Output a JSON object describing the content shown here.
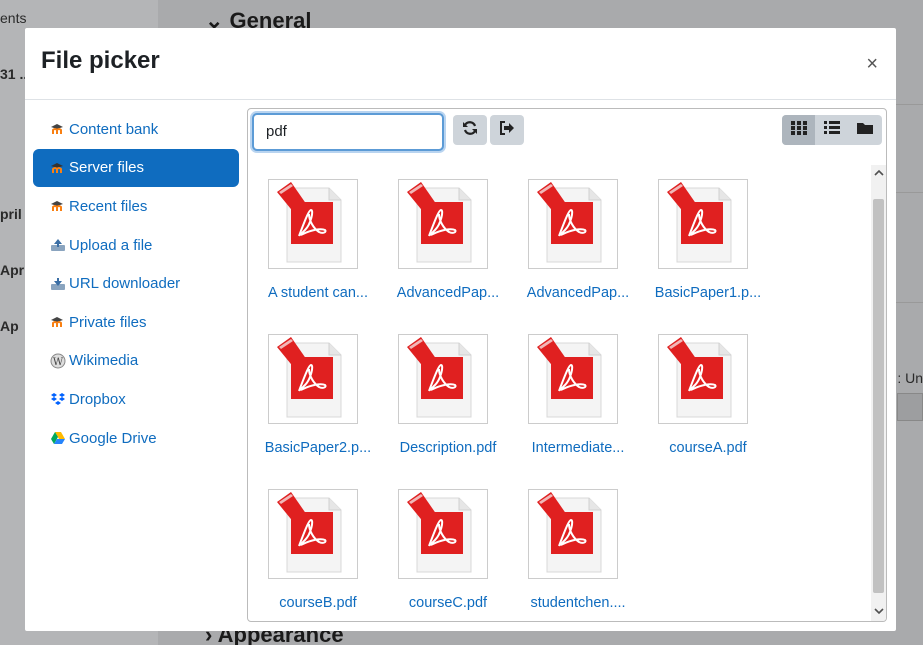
{
  "background": {
    "left_fragments": [
      "ents",
      "31 ..",
      "pril",
      "Apr",
      "Ap"
    ],
    "heading_top": "General",
    "heading_bottom": "Appearance",
    "right_fragment": ": Un"
  },
  "modal": {
    "title": "File picker",
    "close_glyph": "×"
  },
  "sidebar": {
    "items": [
      {
        "label": "Content bank",
        "icon": "moodle-icon"
      },
      {
        "label": "Server files",
        "icon": "moodle-icon",
        "active": true
      },
      {
        "label": "Recent files",
        "icon": "moodle-icon"
      },
      {
        "label": "Upload a file",
        "icon": "upload-icon"
      },
      {
        "label": "URL downloader",
        "icon": "url-download-icon"
      },
      {
        "label": "Private files",
        "icon": "moodle-icon"
      },
      {
        "label": "Wikimedia",
        "icon": "wikimedia-icon"
      },
      {
        "label": "Dropbox",
        "icon": "dropbox-icon"
      },
      {
        "label": "Google Drive",
        "icon": "google-drive-icon"
      }
    ]
  },
  "toolbar": {
    "search_value": "pdf",
    "refresh_icon": "refresh-icon",
    "logout_icon": "logout-icon",
    "views": [
      "grid-view-icon",
      "list-view-icon",
      "folder-view-icon"
    ]
  },
  "files": [
    {
      "name": "A student can..."
    },
    {
      "name": "AdvancedPap..."
    },
    {
      "name": "AdvancedPap..."
    },
    {
      "name": "BasicPaper1.p..."
    },
    {
      "name": "BasicPaper2.p..."
    },
    {
      "name": "Description.pdf"
    },
    {
      "name": "Intermediate..."
    },
    {
      "name": "courseA.pdf"
    },
    {
      "name": "courseB.pdf"
    },
    {
      "name": "courseC.pdf"
    },
    {
      "name": "studentchen...."
    }
  ],
  "colors": {
    "accent": "#0f6cbf",
    "pdf_red": "#e02020"
  }
}
